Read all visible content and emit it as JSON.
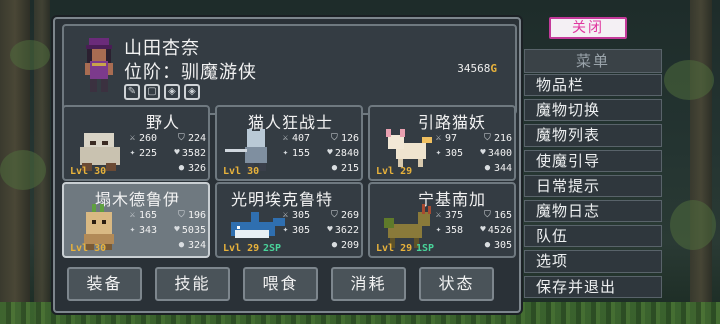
{
  "character": {
    "name": "山田杏奈",
    "rank": "位阶：驯魔游侠",
    "gold": "34568",
    "gold_symbol": "G",
    "status_icons": [
      "quill-icon",
      "lock-icon",
      "diamond-icon",
      "diamond-icon"
    ]
  },
  "monsters": [
    {
      "name": "野人",
      "level": "Lvl 30",
      "sp": "",
      "atk": "260",
      "def": "224",
      "mag": "225",
      "hp": "3582",
      "mp": "326",
      "sprite": "yeti",
      "selected": false
    },
    {
      "name": "猫人狂战士",
      "level": "Lvl 30",
      "sp": "",
      "atk": "407",
      "def": "126",
      "mag": "155",
      "hp": "2840",
      "mp": "215",
      "sprite": "catknight",
      "selected": false
    },
    {
      "name": "引路猫妖",
      "level": "Lvl 29",
      "sp": "",
      "atk": "97",
      "def": "216",
      "mag": "305",
      "hp": "3400",
      "mp": "344",
      "sprite": "foxcat",
      "selected": false
    },
    {
      "name": "塌木德鲁伊",
      "level": "Lvl 30",
      "sp": "",
      "atk": "165",
      "def": "196",
      "mag": "343",
      "hp": "5035",
      "mp": "324",
      "sprite": "druid",
      "selected": true
    },
    {
      "name": "光明埃克鲁特",
      "level": "Lvl 29",
      "sp": "2SP",
      "atk": "305",
      "def": "269",
      "mag": "305",
      "hp": "3622",
      "mp": "209",
      "sprite": "orca",
      "selected": false
    },
    {
      "name": "宁基南加",
      "level": "Lvl 29",
      "sp": "1SP",
      "atk": "375",
      "def": "165",
      "mag": "358",
      "hp": "4526",
      "mp": "305",
      "sprite": "deer",
      "selected": false
    }
  ],
  "buttons": [
    "装备",
    "技能",
    "喂食",
    "消耗",
    "状态"
  ],
  "menu": {
    "close": "关闭",
    "title": "菜单",
    "items": [
      "物品栏",
      "魔物切换",
      "魔物列表",
      "使魔引导",
      "日常提示",
      "魔物日志",
      "队伍",
      "选项",
      "保存并退出"
    ]
  },
  "colors": {
    "level": "#e8b23b",
    "sp": "#49d39a",
    "close": "#e0369f",
    "gold": "#e8b23b"
  }
}
